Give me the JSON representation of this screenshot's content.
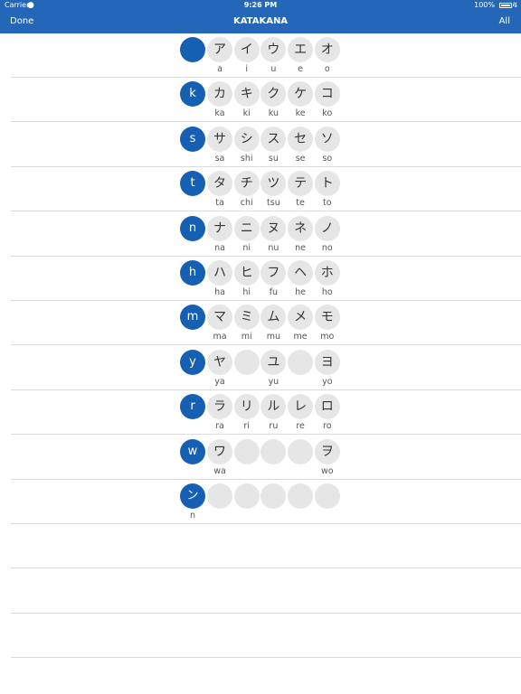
{
  "status_bar": {
    "carrier": "Carrier",
    "wifi_icon": "wifi-icon",
    "time": "9:26 PM",
    "battery": "100%"
  },
  "nav": {
    "left_label": "Done",
    "title": "KATAKANA",
    "right_label": "All"
  },
  "colors": {
    "nav_bg": "#2467b8",
    "row_head": "#1560b3",
    "kana_bg": "#e6e6e6"
  },
  "rows": [
    {
      "head": "",
      "cells": [
        {
          "kana": "ア",
          "romaji": "a"
        },
        {
          "kana": "イ",
          "romaji": "i"
        },
        {
          "kana": "ウ",
          "romaji": "u"
        },
        {
          "kana": "エ",
          "romaji": "e"
        },
        {
          "kana": "オ",
          "romaji": "o"
        }
      ]
    },
    {
      "head": "k",
      "cells": [
        {
          "kana": "カ",
          "romaji": "ka"
        },
        {
          "kana": "キ",
          "romaji": "ki"
        },
        {
          "kana": "ク",
          "romaji": "ku"
        },
        {
          "kana": "ケ",
          "romaji": "ke"
        },
        {
          "kana": "コ",
          "romaji": "ko"
        }
      ]
    },
    {
      "head": "s",
      "cells": [
        {
          "kana": "サ",
          "romaji": "sa"
        },
        {
          "kana": "シ",
          "romaji": "shi"
        },
        {
          "kana": "ス",
          "romaji": "su"
        },
        {
          "kana": "セ",
          "romaji": "se"
        },
        {
          "kana": "ソ",
          "romaji": "so"
        }
      ]
    },
    {
      "head": "t",
      "cells": [
        {
          "kana": "タ",
          "romaji": "ta"
        },
        {
          "kana": "チ",
          "romaji": "chi"
        },
        {
          "kana": "ツ",
          "romaji": "tsu"
        },
        {
          "kana": "テ",
          "romaji": "te"
        },
        {
          "kana": "ト",
          "romaji": "to"
        }
      ]
    },
    {
      "head": "n",
      "cells": [
        {
          "kana": "ナ",
          "romaji": "na"
        },
        {
          "kana": "ニ",
          "romaji": "ni"
        },
        {
          "kana": "ヌ",
          "romaji": "nu"
        },
        {
          "kana": "ネ",
          "romaji": "ne"
        },
        {
          "kana": "ノ",
          "romaji": "no"
        }
      ]
    },
    {
      "head": "h",
      "cells": [
        {
          "kana": "ハ",
          "romaji": "ha"
        },
        {
          "kana": "ヒ",
          "romaji": "hi"
        },
        {
          "kana": "フ",
          "romaji": "fu"
        },
        {
          "kana": "ヘ",
          "romaji": "he"
        },
        {
          "kana": "ホ",
          "romaji": "ho"
        }
      ]
    },
    {
      "head": "m",
      "cells": [
        {
          "kana": "マ",
          "romaji": "ma"
        },
        {
          "kana": "ミ",
          "romaji": "mi"
        },
        {
          "kana": "ム",
          "romaji": "mu"
        },
        {
          "kana": "メ",
          "romaji": "me"
        },
        {
          "kana": "モ",
          "romaji": "mo"
        }
      ]
    },
    {
      "head": "y",
      "cells": [
        {
          "kana": "ヤ",
          "romaji": "ya"
        },
        {
          "kana": "",
          "romaji": ""
        },
        {
          "kana": "ユ",
          "romaji": "yu"
        },
        {
          "kana": "",
          "romaji": ""
        },
        {
          "kana": "ヨ",
          "romaji": "yo"
        }
      ]
    },
    {
      "head": "r",
      "cells": [
        {
          "kana": "ラ",
          "romaji": "ra"
        },
        {
          "kana": "リ",
          "romaji": "ri"
        },
        {
          "kana": "ル",
          "romaji": "ru"
        },
        {
          "kana": "レ",
          "romaji": "re"
        },
        {
          "kana": "ロ",
          "romaji": "ro"
        }
      ]
    },
    {
      "head": "w",
      "cells": [
        {
          "kana": "ワ",
          "romaji": "wa"
        },
        {
          "kana": "",
          "romaji": ""
        },
        {
          "kana": "",
          "romaji": ""
        },
        {
          "kana": "",
          "romaji": ""
        },
        {
          "kana": "ヲ",
          "romaji": "wo"
        }
      ]
    },
    {
      "head": "ン",
      "head_romaji": "n",
      "cells": [
        {
          "kana": "",
          "romaji": ""
        },
        {
          "kana": "",
          "romaji": ""
        },
        {
          "kana": "",
          "romaji": ""
        },
        {
          "kana": "",
          "romaji": ""
        },
        {
          "kana": "",
          "romaji": ""
        }
      ]
    }
  ]
}
